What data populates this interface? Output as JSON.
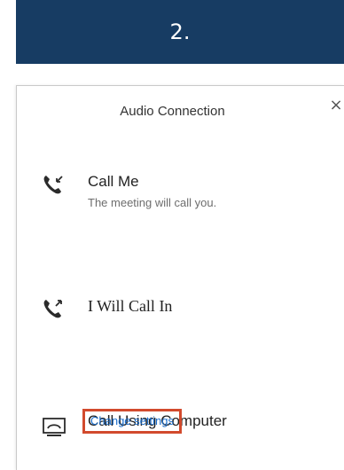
{
  "banner": {
    "step_label": "2."
  },
  "dialog": {
    "title": "Audio Connection",
    "close_glyph": "×",
    "options": [
      {
        "label": "Call Me",
        "sublabel": "The meeting will call you.",
        "icon": "phone-incoming-icon"
      },
      {
        "label": "I Will Call In",
        "icon": "phone-outgoing-icon"
      },
      {
        "label": "Call Using Computer",
        "icon": "computer-icon"
      }
    ],
    "change_settings_label": "Change settings"
  },
  "colors": {
    "banner_bg": "#173c63",
    "link": "#1b6ecc",
    "highlight_border": "#d24a2d"
  }
}
